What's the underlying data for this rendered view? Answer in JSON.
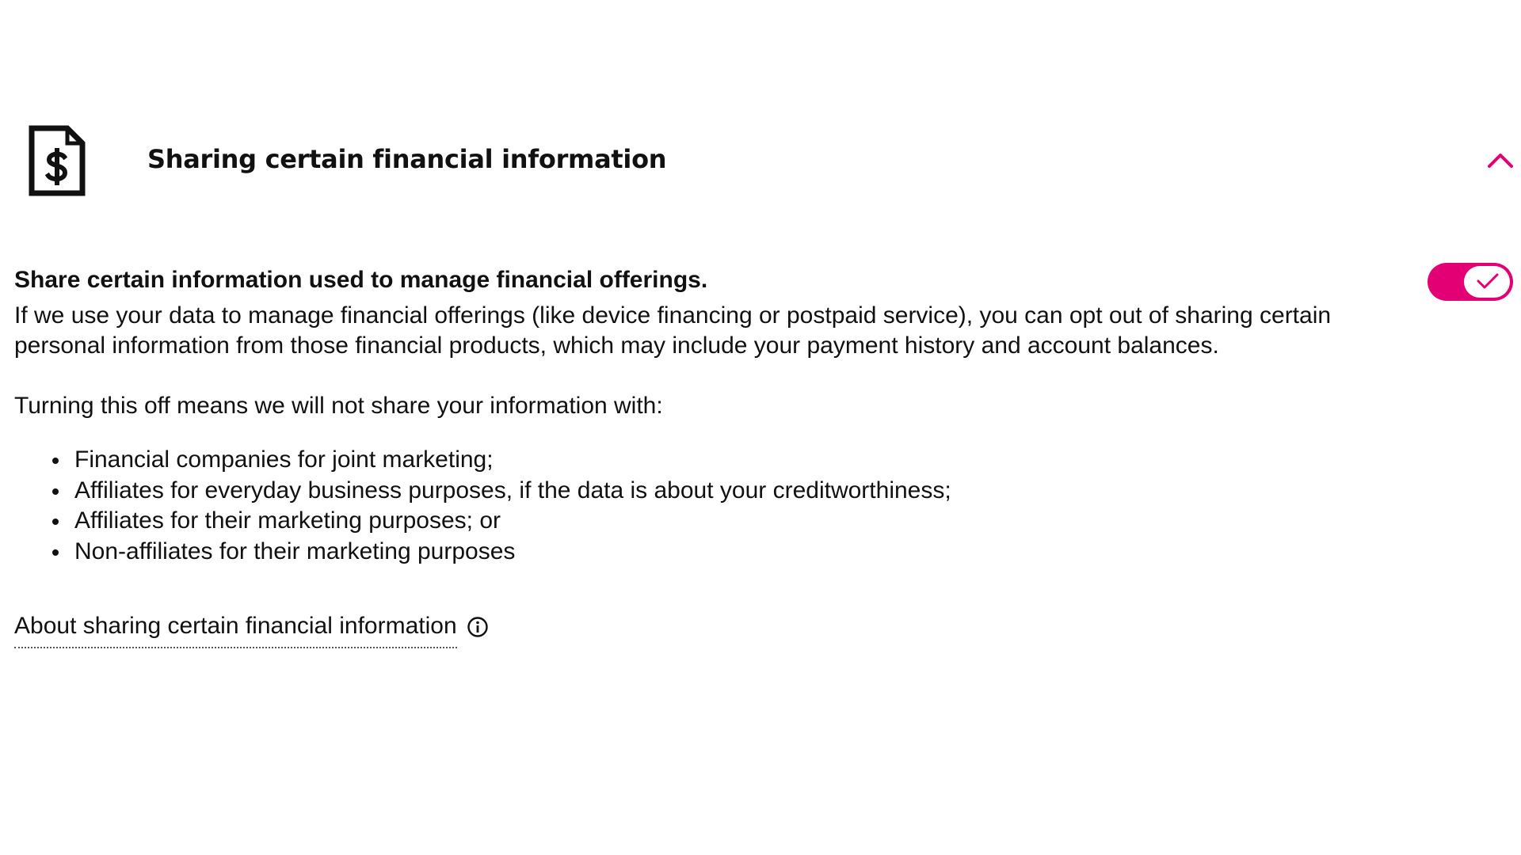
{
  "section": {
    "title": "Sharing certain financial information",
    "icon": "dollar-document-icon",
    "expanded": true,
    "accent_color": "#e20074"
  },
  "setting": {
    "heading": "Share certain information used to manage financial offerings.",
    "description": "If we use your data to manage financial offerings (like device financing or postpaid service), you can opt out of sharing certain personal information from those financial products, which may include your payment history and account balances.",
    "intro": "Turning this off means we will not share your information with:",
    "bullets": [
      "Financial companies for joint marketing;",
      "Affiliates for everyday business purposes, if the data is about your creditworthiness;",
      "Affiliates for their marketing purposes; or",
      "Non-affiliates for their marketing purposes"
    ],
    "toggle_on": true
  },
  "about_link": {
    "label": "About sharing certain financial information",
    "icon": "info-icon"
  }
}
